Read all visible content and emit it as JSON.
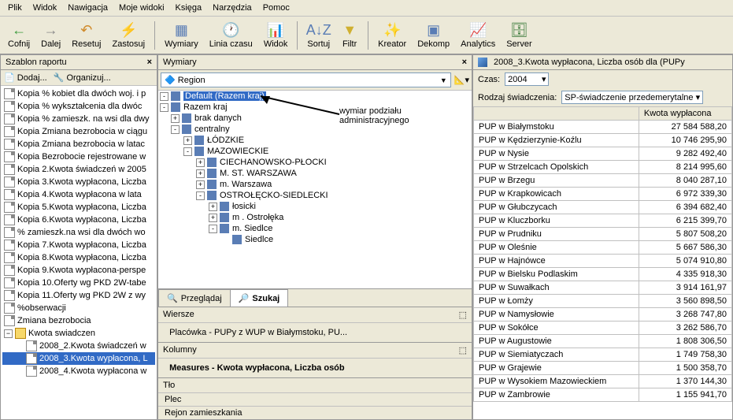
{
  "menu": [
    "Plik",
    "Widok",
    "Nawigacja",
    "Moje widoki",
    "Księga",
    "Narzędzia",
    "Pomoc"
  ],
  "toolbar": [
    {
      "label": "Cofnij",
      "icon": "back",
      "color": "#3a9a3a"
    },
    {
      "label": "Dalej",
      "icon": "fwd",
      "color": "#888"
    },
    {
      "label": "Resetuj",
      "icon": "reset",
      "color": "#d08a2a"
    },
    {
      "label": "Zastosuj",
      "icon": "apply",
      "color": "#888"
    },
    {
      "sep": true
    },
    {
      "label": "Wymiary",
      "icon": "dims",
      "color": "#5a7db5"
    },
    {
      "label": "Linia czasu",
      "icon": "time",
      "color": "#5a7db5"
    },
    {
      "label": "Widok",
      "icon": "view",
      "color": "#5a7db5"
    },
    {
      "sep": true
    },
    {
      "label": "Sortuj",
      "icon": "sort",
      "color": "#5a7db5"
    },
    {
      "label": "Filtr",
      "icon": "filter",
      "color": "#d0b030"
    },
    {
      "sep": true
    },
    {
      "label": "Kreator",
      "icon": "wiz",
      "color": "#5a7db5"
    },
    {
      "label": "Dekomp",
      "icon": "decomp",
      "color": "#5a7db5"
    },
    {
      "label": "Analytics",
      "icon": "analytics",
      "color": "#5a7db5"
    },
    {
      "label": "Server",
      "icon": "server",
      "color": "#3a7a3a"
    }
  ],
  "left": {
    "title": "Szablon raportu",
    "add": "Dodaj...",
    "org": "Organizuj...",
    "items": [
      "Kopia % kobiet dla dwóch woj. i p",
      "Kopia % wykształcenia dla dwóc",
      "Kopia % zamieszk. na wsi dla dwy",
      "Kopia Zmiana bezrobocia w ciągu",
      "Kopia Zmiana bezrobocia w latac",
      "Kopia Bezrobocie rejestrowane w",
      "Kopia 2.Kwota świadczeń w 2005",
      "Kopia 3.Kwota wypłacona, Liczba",
      "Kopia 4.Kwota wypłacona w lata",
      "Kopia 5.Kwota wypłacona, Liczba",
      "Kopia 6.Kwota wypłacona, Liczba",
      "% zamieszk.na wsi dla dwóch wo",
      "Kopia 7.Kwota wypłacona, Liczba",
      "Kopia 8.Kwota wypłacona, Liczba",
      "Kopia 9.Kwota wypłacona-perspe",
      "Kopia 10.Oferty wg PKD 2W-tabe",
      "Kopia 11.Oferty wg PKD 2W z wy",
      "%obserwacji",
      "Zmiana bezrobocia"
    ],
    "folder": "Kwota swiadczen",
    "folderItems": [
      "2008_2.Kwota świadczeń w",
      "2008_3.Kwota wypłacona, L",
      "2008_4.Kwota wypłacona w"
    ],
    "selectedFolderItem": 1
  },
  "mid": {
    "title": "Wymiary",
    "combo": "Region",
    "annotation": "wymiar podziału\nadministracyjnego",
    "tree": [
      {
        "l": 0,
        "exp": "-",
        "label": "Default (Razem kraj)",
        "sel": true
      },
      {
        "l": 0,
        "exp": "-",
        "label": "Razem kraj"
      },
      {
        "l": 1,
        "exp": "+",
        "label": "brak danych"
      },
      {
        "l": 1,
        "exp": "-",
        "label": "centralny"
      },
      {
        "l": 2,
        "exp": "+",
        "label": "ŁÓDZKIE"
      },
      {
        "l": 2,
        "exp": "-",
        "label": "MAZOWIECKIE"
      },
      {
        "l": 3,
        "exp": "+",
        "label": "CIECHANOWSKO-PŁOCKI"
      },
      {
        "l": 3,
        "exp": "+",
        "label": "M. ST. WARSZAWA"
      },
      {
        "l": 3,
        "exp": "+",
        "label": "m. Warszawa"
      },
      {
        "l": 3,
        "exp": "-",
        "label": "OSTROŁĘCKO-SIEDLECKI"
      },
      {
        "l": 4,
        "exp": "+",
        "label": "łosicki"
      },
      {
        "l": 4,
        "exp": "+",
        "label": "m . Ostrołęka"
      },
      {
        "l": 4,
        "exp": "-",
        "label": "m. Siedlce"
      },
      {
        "l": 5,
        "exp": "",
        "label": "Siedlce"
      }
    ],
    "tabs": {
      "browse": "Przeglądaj",
      "search": "Szukaj"
    },
    "rows": {
      "title": "Wiersze",
      "body": "Placówka - PUPy z WUP w Białymstoku, PU..."
    },
    "cols": {
      "title": "Kolumny",
      "body": "Measures - Kwota wypłacona, Liczba osób"
    },
    "bg": {
      "title": "Tło",
      "body1": "Plec",
      "body2": "Rejon zamieszkania"
    }
  },
  "right": {
    "title": "2008_3.Kwota wypłacona, Liczba osób dla   (PUPy",
    "timeLabel": "Czas:",
    "timeVal": "2004",
    "svcLabel": "Rodzaj świadczenia:",
    "svcVal": "SP-świadczenie przedemerytalne",
    "col1": "",
    "col2": "Kwota wypłacona",
    "rows": [
      [
        "PUP w Białymstoku",
        "27 584 588,20"
      ],
      [
        "PUP w Kędzierzynie-Koźlu",
        "10 746 295,90"
      ],
      [
        "PUP w Nysie",
        "9 282 492,40"
      ],
      [
        "PUP w Strzelcach Opolskich",
        "8 214 995,60"
      ],
      [
        "PUP w Brzegu",
        "8 040 287,10"
      ],
      [
        "PUP w Krapkowicach",
        "6 972 339,30"
      ],
      [
        "PUP w Głubczycach",
        "6 394 682,40"
      ],
      [
        "PUP w Kluczborku",
        "6 215 399,70"
      ],
      [
        "PUP w Prudniku",
        "5 807 508,20"
      ],
      [
        "PUP w Oleśnie",
        "5 667 586,30"
      ],
      [
        "PUP w Hajnówce",
        "5 074 910,80"
      ],
      [
        "PUP w Bielsku Podlaskim",
        "4 335 918,30"
      ],
      [
        "PUP w Suwałkach",
        "3 914 161,97"
      ],
      [
        "PUP w Łomży",
        "3 560 898,50"
      ],
      [
        "PUP w Namysłowie",
        "3 268 747,80"
      ],
      [
        "PUP w Sokółce",
        "3 262 586,70"
      ],
      [
        "PUP w Augustowie",
        "1 808 306,50"
      ],
      [
        "PUP w Siemiatyczach",
        "1 749 758,30"
      ],
      [
        "PUP w Grajewie",
        "1 500 358,70"
      ],
      [
        "PUP w Wysokiem Mazowieckiem",
        "1 370 144,30"
      ],
      [
        "PUP w Zambrowie",
        "1 155 941,70"
      ]
    ]
  }
}
